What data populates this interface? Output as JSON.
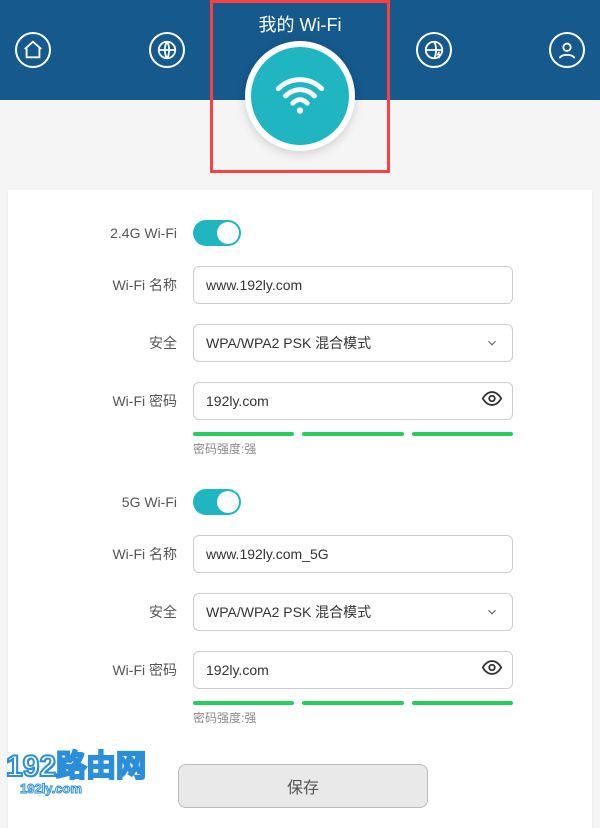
{
  "header": {
    "title": "我的 Wi-Fi"
  },
  "nav": {
    "home": "home-icon",
    "internet": "globe-icon",
    "wifi": "wifi-icon",
    "globe_fast": "globe-lightning-icon",
    "account": "user-icon"
  },
  "wifi24": {
    "toggle_label": "2.4G Wi-Fi",
    "name_label": "Wi-Fi 名称",
    "name_value": "www.192ly.com",
    "security_label": "安全",
    "security_value": "WPA/WPA2 PSK 混合模式",
    "password_label": "Wi-Fi 密码",
    "password_value": "192ly.com",
    "strength_text": "密码强度:强"
  },
  "wifi5": {
    "toggle_label": "5G Wi-Fi",
    "name_label": "Wi-Fi 名称",
    "name_value": "www.192ly.com_5G",
    "security_label": "安全",
    "security_value": "WPA/WPA2 PSK 混合模式",
    "password_label": "Wi-Fi 密码",
    "password_value": "192ly.com",
    "strength_text": "密码强度:强"
  },
  "actions": {
    "save": "保存"
  },
  "watermark": {
    "main": "192路由网",
    "sub": "192ly.com"
  }
}
